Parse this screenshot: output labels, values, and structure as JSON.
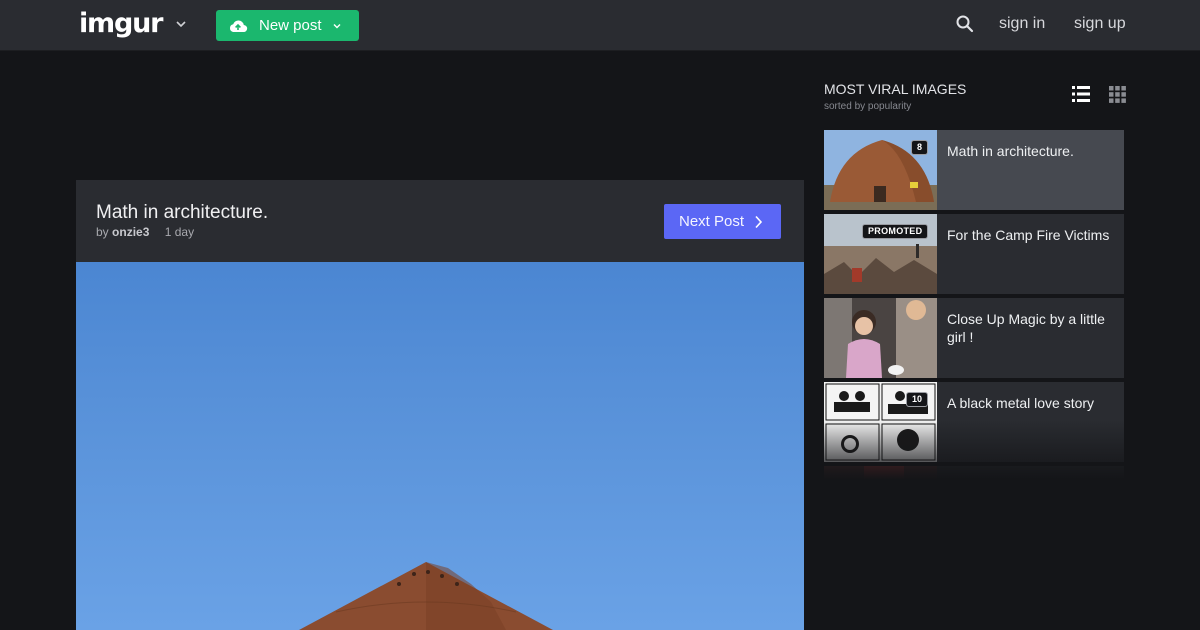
{
  "header": {
    "logo": "imgur",
    "new_post_label": "New post",
    "sign_in": "sign in",
    "sign_up": "sign up"
  },
  "post": {
    "title": "Math in architecture.",
    "by": "by",
    "author": "onzie3",
    "age": "1 day",
    "next_label": "Next Post"
  },
  "sidebar": {
    "title": "MOST VIRAL IMAGES",
    "subtitle": "sorted by popularity",
    "items": [
      {
        "title": "Math in architecture.",
        "badge": "8"
      },
      {
        "title": "For the Camp Fire Victims",
        "badge": "PROMOTED"
      },
      {
        "title": "Close Up Magic by a little girl !"
      },
      {
        "title": "A black metal love story",
        "badge": "10"
      }
    ]
  },
  "colors": {
    "background": "#141518",
    "panel": "#2a2c31",
    "new_post_green": "#1bb76e",
    "next_button_blue": "#5b67f5"
  }
}
